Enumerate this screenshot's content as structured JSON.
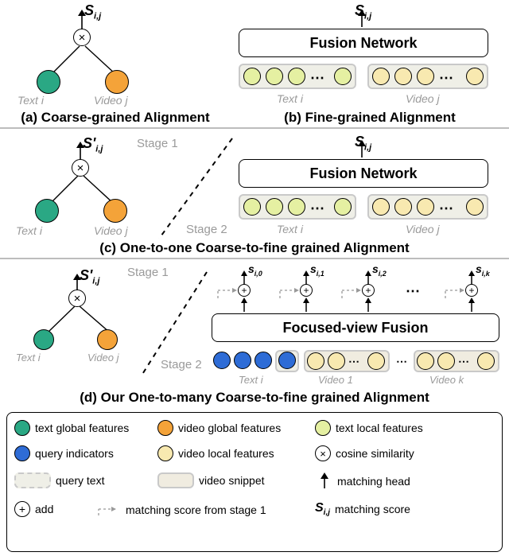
{
  "chart_data": {
    "type": "diagram",
    "title": "Alignment paradigm comparison",
    "panels": [
      {
        "id": "a",
        "caption": "(a) Coarse-grained Alignment",
        "inputs": [
          {
            "role": "text global features",
            "label": "Text i"
          },
          {
            "role": "video global features",
            "label": "Video j"
          }
        ],
        "op": "cosine similarity",
        "output": "S_{i,j}"
      },
      {
        "id": "b",
        "caption": "(b) Fine-grained Alignment",
        "inputs": [
          {
            "role": "text local features",
            "label": "Text i"
          },
          {
            "role": "video local features",
            "label": "Video j"
          }
        ],
        "module": "Fusion Network",
        "output": "S_{i,j}"
      },
      {
        "id": "c",
        "caption": "(c) One-to-one Coarse-to-fine grained Alignment",
        "stage1": {
          "inputs": [
            "Text i",
            "Video j"
          ],
          "op": "cosine similarity",
          "output": "S'_{i,j}"
        },
        "stage2": {
          "inputs": [
            "Text i (local)",
            "Video j (local)"
          ],
          "module": "Fusion Network",
          "output": "S_{i,j}"
        }
      },
      {
        "id": "d",
        "caption": "(d) Our One-to-many Coarse-to-fine grained Alignment",
        "stage1": {
          "inputs": [
            "Text i",
            "Video j"
          ],
          "op": "cosine similarity",
          "output": "S'_{i,j}"
        },
        "stage2": {
          "text": {
            "role": "query indicators",
            "label": "Text i"
          },
          "videos": [
            "Video 1",
            "...",
            "Video k"
          ],
          "module": "Focused-view Fusion",
          "outputs": [
            "s_{i,0}",
            "s_{i,1}",
            "s_{i,2}",
            "...",
            "s_{i,k}"
          ],
          "combine": "add score from stage 1"
        }
      }
    ],
    "legend": {
      "text global features": "green circle",
      "video global features": "orange circle",
      "text local features": "light-green circle",
      "query indicators": "blue circle",
      "video local features": "light-yellow circle",
      "cosine similarity": "circled ×",
      "query text": "dashed grey rounded box",
      "video snippet": "grey rounded box",
      "matching head": "black arrow up",
      "add": "circled +",
      "matching score from stage 1": "dashed grey arrow",
      "matching score": "S_{i,j}"
    }
  },
  "panelA": {
    "caption": "(a) Coarse-grained Alignment",
    "score": "S",
    "score_sub": "i,j",
    "text_label": "Text i",
    "video_label": "Video j",
    "op_symbol": "×"
  },
  "panelB": {
    "caption": "(b) Fine-grained Alignment",
    "score": "S",
    "score_sub": "i,j",
    "module": "Fusion Network",
    "text_label": "Text i",
    "video_label": "Video j",
    "ellipsis": "⋯"
  },
  "panelC": {
    "caption": "(c) One-to-one Coarse-to-fine grained Alignment",
    "stage1": "Stage 1",
    "stage2": "Stage 2",
    "scoreA": "S'",
    "scoreA_sub": "i,j",
    "scoreB": "S",
    "scoreB_sub": "i,j",
    "module": "Fusion Network",
    "text_label": "Text i",
    "video_label": "Video j",
    "op_symbol": "×",
    "ellipsis": "⋯"
  },
  "panelD": {
    "caption": "(d) Our One-to-many Coarse-to-fine grained Alignment",
    "stage1": "Stage 1",
    "stage2": "Stage 2",
    "scoreA": "S'",
    "scoreA_sub": "i,j",
    "module": "Focused-view Fusion",
    "text_label": "Text i",
    "video_label": "Video j",
    "video1": "Video 1",
    "videok": "Video k",
    "op_symbol": "×",
    "ellipsis": "⋯",
    "outs": {
      "s0": "s",
      "s0sub": "i,0",
      "s1": "s",
      "s1sub": "i,1",
      "s2": "s",
      "s2sub": "i,2",
      "sk": "s",
      "sksub": "i,k"
    },
    "plus": "+"
  },
  "legend": {
    "text_global": "text global features",
    "video_global": "video global features",
    "text_local": "text local features",
    "query_ind": "query indicators",
    "video_local": "video local features",
    "cosine": "cosine similarity",
    "query_text": "query text",
    "video_snip": "video snippet",
    "matching_head": "matching head",
    "add": "add",
    "stage1_arrow": "matching score from stage 1",
    "score": "S",
    "score_sub": "i,j",
    "score_txt": "matching score",
    "mul": "×",
    "plus": "+"
  }
}
